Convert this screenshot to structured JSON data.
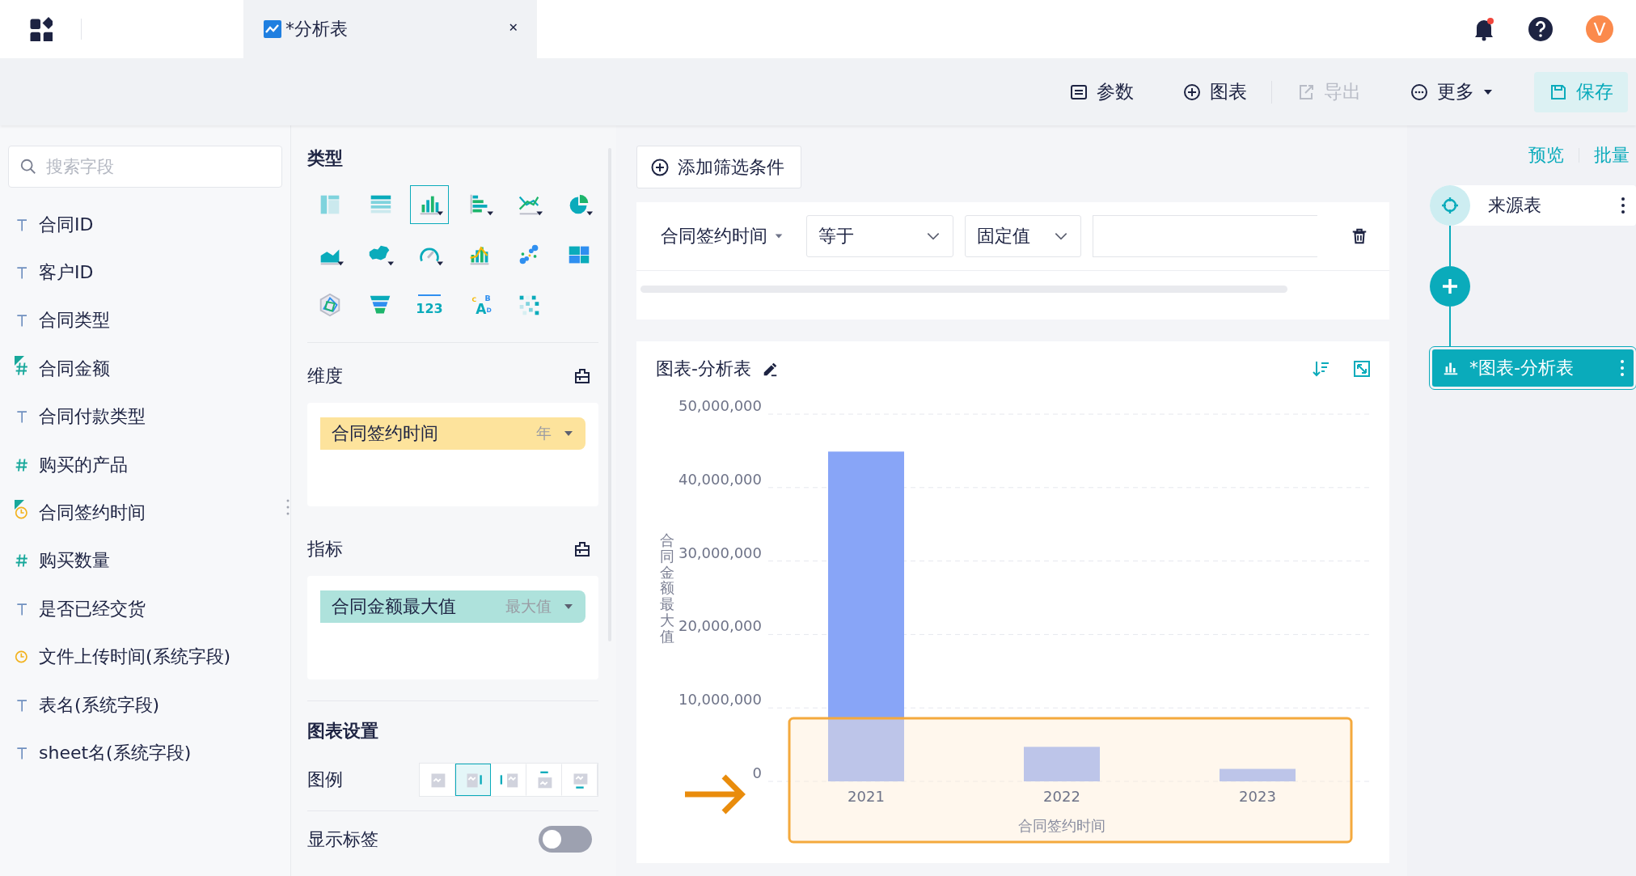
{
  "topbar": {
    "tab": {
      "title": "*分析表",
      "selected": true
    },
    "avatar": "V",
    "notifications": true
  },
  "toolbar": [
    {
      "kind": "params",
      "label": "参数",
      "disabled": false
    },
    {
      "kind": "chart",
      "label": "图表",
      "disabled": false
    },
    {
      "kind": "export",
      "label": "导出",
      "disabled": true
    },
    {
      "kind": "more",
      "label": "更多",
      "disabled": false
    },
    {
      "kind": "save",
      "label": "保存",
      "disabled": false
    }
  ],
  "fields": {
    "search_placeholder": "搜索字段",
    "items": [
      {
        "name": "合同ID",
        "kind": "text",
        "in_use": false
      },
      {
        "name": "客户ID",
        "kind": "text",
        "in_use": false
      },
      {
        "name": "合同类型",
        "kind": "text",
        "in_use": false
      },
      {
        "name": "合同金额",
        "kind": "number",
        "in_use": true
      },
      {
        "name": "合同付款类型",
        "kind": "text",
        "in_use": false
      },
      {
        "name": "购买的产品",
        "kind": "number",
        "in_use": false
      },
      {
        "name": "合同签约时间",
        "kind": "date",
        "in_use": true
      },
      {
        "name": "购买数量",
        "kind": "number",
        "in_use": false
      },
      {
        "name": "是否已经交货",
        "kind": "text",
        "in_use": false
      },
      {
        "name": "文件上传时间(系统字段)",
        "kind": "date",
        "in_use": false
      },
      {
        "name": "表名(系统字段)",
        "kind": "text",
        "in_use": false
      },
      {
        "name": "sheet名(系统字段)",
        "kind": "text",
        "in_use": false
      }
    ]
  },
  "config": {
    "type_title": "类型",
    "chart_types": [
      {
        "kind": "pivot",
        "selected": false
      },
      {
        "kind": "table",
        "selected": false
      },
      {
        "kind": "column",
        "selected": true
      },
      {
        "kind": "bar",
        "selected": false
      },
      {
        "kind": "line",
        "selected": false
      },
      {
        "kind": "pie",
        "selected": false
      },
      {
        "kind": "area",
        "selected": false
      },
      {
        "kind": "map",
        "selected": false
      },
      {
        "kind": "gauge",
        "selected": false
      },
      {
        "kind": "combo",
        "selected": false
      },
      {
        "kind": "scatter",
        "selected": false
      },
      {
        "kind": "treemap",
        "selected": false
      },
      {
        "kind": "radar",
        "selected": false
      },
      {
        "kind": "funnel",
        "selected": false
      },
      {
        "kind": "kpi",
        "label": "123",
        "selected": false
      },
      {
        "kind": "wordcloud",
        "letters": [
          "C",
          "A",
          "B",
          "D"
        ],
        "selected": false
      },
      {
        "kind": "heatmap",
        "selected": false
      }
    ],
    "dimension": {
      "title": "维度",
      "pill": {
        "label": "合同签约时间",
        "aggregate": "年"
      }
    },
    "measure": {
      "title": "指标",
      "pill": {
        "label": "合同金额最大值",
        "aggregate": "最大值"
      }
    },
    "settings_title": "图表设置",
    "legend": {
      "label": "图例",
      "options": [
        {
          "kind": "none",
          "selected": false
        },
        {
          "kind": "right",
          "selected": true
        },
        {
          "kind": "left",
          "selected": false
        },
        {
          "kind": "top",
          "selected": false
        },
        {
          "kind": "bottom",
          "selected": false
        }
      ]
    },
    "show_labels": {
      "label": "显示标签",
      "on": false
    }
  },
  "filter": {
    "add_button": "添加筛选条件",
    "field": "合同签约时间",
    "operator": "等于",
    "value_type": "固定值"
  },
  "chart_card": {
    "title": "图表-分析表",
    "chart_data": {
      "type": "bar",
      "categories": [
        "2021",
        "2022",
        "2023"
      ],
      "series": [
        {
          "color": "#88a5f7",
          "values": [
            44900000,
            4700000,
            1700000
          ]
        }
      ],
      "ylim": [
        0,
        50000000
      ],
      "yticks": [
        {
          "value": 0,
          "label": "0"
        },
        {
          "value": 10000000,
          "label": "10,000,000"
        },
        {
          "value": 20000000,
          "label": "20,000,000"
        },
        {
          "value": 30000000,
          "label": "30,000,000"
        },
        {
          "value": 40000000,
          "label": "40,000,000"
        },
        {
          "value": 50000000,
          "label": "50,000,000"
        }
      ],
      "xlabel": "合同签约时间",
      "ylabel": "合同金额最大值",
      "grid": true
    },
    "overlay": {
      "kind": "highlight"
    }
  },
  "flow": {
    "links": [
      "预览",
      "批量"
    ],
    "nodes": [
      {
        "kind": "source",
        "label": "来源表",
        "selected": false
      },
      {
        "kind": "add"
      },
      {
        "kind": "chart",
        "label": "*图表-分析表",
        "selected": true
      }
    ]
  }
}
